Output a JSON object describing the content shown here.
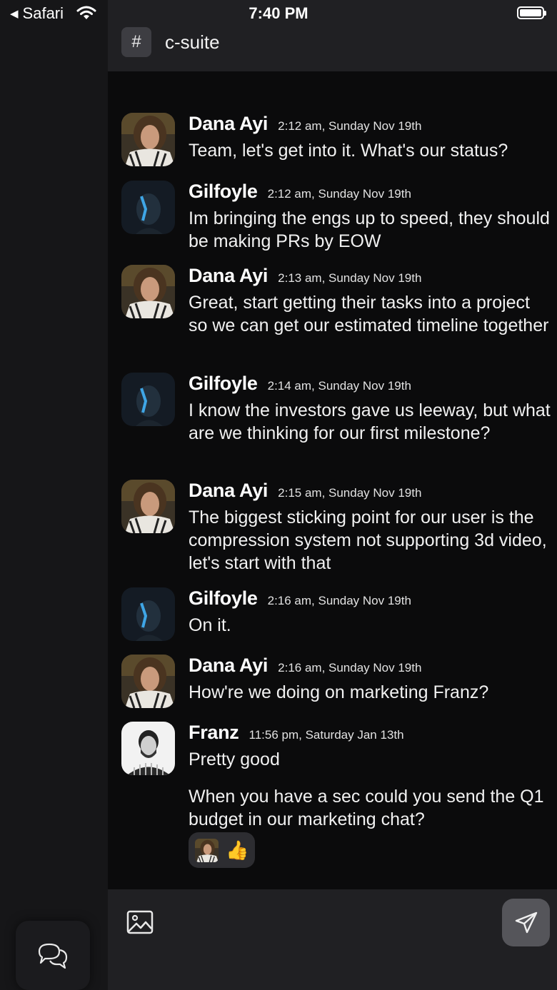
{
  "status_bar": {
    "back_label": "Safari",
    "time": "7:40 PM"
  },
  "header": {
    "channel_icon": "#",
    "channel_name": "c-suite"
  },
  "messages": [
    {
      "author": "Dana Ayi",
      "time": "2:12 am, Sunday Nov 19th",
      "text": "Team, let's get into it. What's our status?",
      "avatar": "dana"
    },
    {
      "author": "Gilfoyle",
      "time": "2:12 am, Sunday Nov 19th",
      "text": "Im bringing the engs up to speed, they should be making PRs by EOW",
      "avatar": "gilfoyle"
    },
    {
      "author": "Dana Ayi",
      "time": "2:13 am, Sunday Nov 19th",
      "text": "Great, start getting their tasks into a project so we can get our estimated timeline together",
      "avatar": "dana"
    },
    {
      "author": "Gilfoyle",
      "time": "2:14 am, Sunday Nov 19th",
      "text": "I know the investors gave us leeway, but what are we thinking for our first milestone?",
      "avatar": "gilfoyle"
    },
    {
      "author": "Dana Ayi",
      "time": "2:15 am, Sunday Nov 19th",
      "text": "The biggest sticking point for our user is the compression system not supporting 3d video, let's start with that",
      "avatar": "dana"
    },
    {
      "author": "Gilfoyle",
      "time": "2:16 am, Sunday Nov 19th",
      "text": "On it.",
      "avatar": "gilfoyle"
    },
    {
      "author": "Dana Ayi",
      "time": "2:16 am, Sunday Nov 19th",
      "text": "How're we doing on marketing Franz?",
      "avatar": "dana"
    },
    {
      "author": "Franz",
      "time": "11:56 pm, Saturday Jan 13th",
      "text": "Pretty good",
      "avatar": "franz"
    }
  ],
  "followup_message": "When you have a sec could you send the Q1 budget in our marketing chat?",
  "reaction": {
    "emoji": "👍",
    "count_avatar": "dana"
  },
  "composer": {
    "image_icon": "image-icon",
    "send_icon": "send-icon"
  },
  "nav": {
    "chat_icon": "chat-bubbles-icon"
  },
  "colors": {
    "background": "#0b0b0c",
    "header": "#202023",
    "sidebar": "#161618",
    "send_button": "#55555a"
  }
}
